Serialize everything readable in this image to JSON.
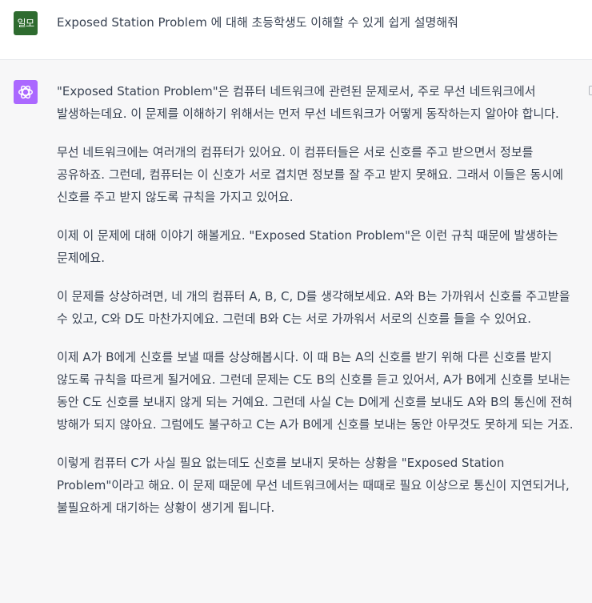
{
  "user": {
    "avatar_text": "일모",
    "avatar_color": "#2e6b2f",
    "message": "Exposed Station Problem 에 대해 초등학생도 이해할 수 있게 쉽게 설명해줘"
  },
  "assistant": {
    "avatar_color": "#ab68ff",
    "paragraphs": [
      "\"Exposed Station Problem\"은 컴퓨터 네트워크에 관련된 문제로서, 주로 무선 네트워크에서 발생하는데요. 이 문제를 이해하기 위해서는 먼저 무선 네트워크가 어떻게 동작하는지 알아야 합니다.",
      "무선 네트워크에는 여러개의 컴퓨터가 있어요. 이 컴퓨터들은 서로 신호를 주고 받으면서 정보를 공유하죠. 그런데, 컴퓨터는 이 신호가 서로 겹치면 정보를 잘 주고 받지 못해요. 그래서 이들은 동시에 신호를 주고 받지 않도록 규칙을 가지고 있어요.",
      "이제 이 문제에 대해 이야기 해볼게요. \"Exposed Station Problem\"은 이런 규칙 때문에 발생하는 문제에요.",
      "이 문제를 상상하려면, 네 개의 컴퓨터 A, B, C, D를 생각해보세요. A와 B는 가까워서 신호를 주고받을 수 있고, C와 D도 마찬가지에요. 그런데 B와 C는 서로 가까워서 서로의 신호를 들을 수 있어요.",
      "이제 A가 B에게 신호를 보낼 때를 상상해봅시다. 이 때 B는 A의 신호를 받기 위해 다른 신호를 받지 않도록 규칙을 따르게 될거에요. 그런데 문제는 C도 B의 신호를 듣고 있어서, A가 B에게 신호를 보내는 동안 C도 신호를 보내지 않게 되는 거예요. 그런데 사실 C는 D에게 신호를 보내도 A와 B의 통신에 전혀 방해가 되지 않아요. 그럼에도 불구하고 C는 A가 B에게 신호를 보내는 동안 아무것도 못하게 되는 거죠.",
      "이렇게 컴퓨터 C가 사실 필요 없는데도 신호를 보내지 못하는 상황을 \"Exposed Station Problem\"이라고 해요. 이 문제 때문에 무선 네트워크에서는 때때로 필요 이상으로 통신이 지연되거나, 불필요하게 대기하는 상황이 생기게 됩니다."
    ]
  },
  "icons": {
    "bot_avatar": "openai-logo-icon",
    "copy": "copy-icon"
  }
}
